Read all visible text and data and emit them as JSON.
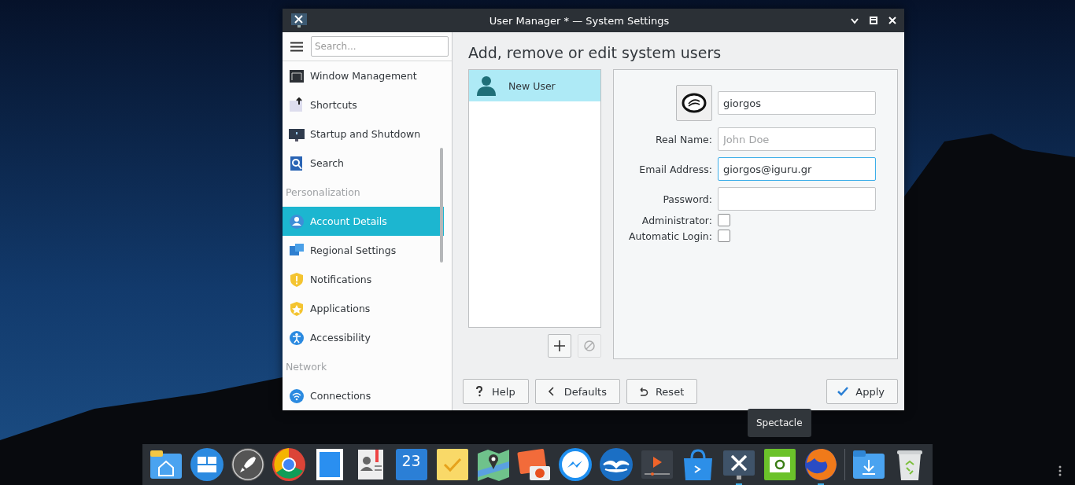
{
  "window": {
    "title": "User Manager * — System Settings"
  },
  "sidebar": {
    "search": {
      "placeholder": "Search..."
    },
    "items": [
      {
        "kind": "item",
        "label": "Window Management",
        "selected": false
      },
      {
        "kind": "item",
        "label": "Shortcuts",
        "selected": false
      },
      {
        "kind": "item",
        "label": "Startup and Shutdown",
        "selected": false
      },
      {
        "kind": "item",
        "label": "Search",
        "selected": false
      },
      {
        "kind": "header",
        "label": "Personalization"
      },
      {
        "kind": "item",
        "label": "Account Details",
        "selected": true
      },
      {
        "kind": "item",
        "label": "Regional Settings",
        "selected": false
      },
      {
        "kind": "item",
        "label": "Notifications",
        "selected": false
      },
      {
        "kind": "item",
        "label": "Applications",
        "selected": false
      },
      {
        "kind": "item",
        "label": "Accessibility",
        "selected": false
      },
      {
        "kind": "header",
        "label": "Network"
      },
      {
        "kind": "item",
        "label": "Connections",
        "selected": false
      }
    ]
  },
  "page": {
    "heading": "Add, remove or edit system users",
    "users": [
      {
        "name": "New User",
        "selected": true
      }
    ],
    "list_buttons": [
      {
        "kind": "add",
        "disabled": false
      },
      {
        "kind": "remove",
        "disabled": true
      }
    ],
    "form": {
      "username": {
        "value": "giorgos",
        "focused": false
      },
      "fields": [
        {
          "label": "Real Name:",
          "placeholder": "John Doe",
          "focused": false
        },
        {
          "label": "Email Address:",
          "value": "giorgos@iguru.gr",
          "focused": true
        },
        {
          "label": "Password:",
          "focused": false
        }
      ],
      "checkboxes": [
        {
          "label": "Administrator:",
          "checked": false
        },
        {
          "label": "Automatic Login:",
          "checked": false
        }
      ]
    },
    "buttons": [
      {
        "kind": "help",
        "label": "Help"
      },
      {
        "kind": "defaults",
        "label": "Defaults"
      },
      {
        "kind": "reset",
        "label": "Reset"
      },
      {
        "kind": "apply",
        "label": "Apply"
      }
    ]
  },
  "dock": {
    "tooltip": "Spectacle",
    "items": [
      {
        "running": false
      },
      {
        "running": false
      },
      {
        "running": false
      },
      {
        "running": false
      },
      {
        "running": false
      },
      {
        "running": false
      },
      {
        "running": false,
        "label": "23"
      },
      {
        "running": false
      },
      {
        "running": false
      },
      {
        "running": false
      },
      {
        "running": false
      },
      {
        "running": false
      },
      {
        "running": false
      },
      {
        "running": false
      },
      {
        "running": true
      },
      {
        "running": false
      },
      {
        "running": true
      },
      {
        "running": false
      },
      {
        "running": false
      }
    ]
  }
}
